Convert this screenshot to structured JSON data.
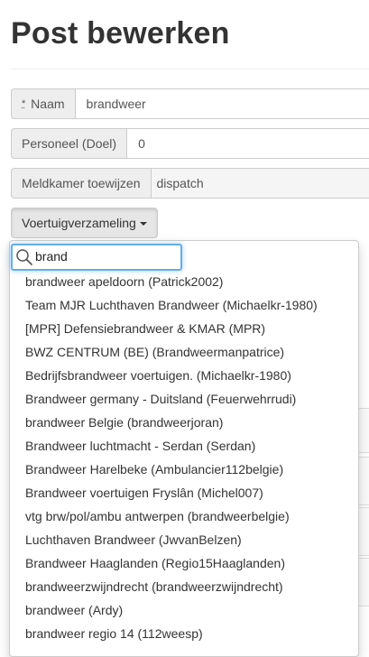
{
  "page": {
    "title": "Post bewerken"
  },
  "form": {
    "naam": {
      "required_mark": "*",
      "label": "Naam",
      "value": "brandweer"
    },
    "personeel": {
      "label": "Personeel (Doel)",
      "value": "0"
    },
    "meldkamer": {
      "label": "Meldkamer toewijzen",
      "value": "dispatch"
    }
  },
  "vehicle_collection": {
    "button_label": "Voertuigverzameling",
    "search": {
      "value": "brand",
      "placeholder": ""
    },
    "options": [
      "brandweer apeldoorn (Patrick2002)",
      "Team MJR Luchthaven Brandweer (Michaelkr-1980)",
      "[MPR] Defensiebrandweer & KMAR (MPR)",
      "BWZ CENTRUM (BE) (Brandweermanpatrice)",
      "Bedrijfsbrandweer voertuigen. (Michaelkr-1980)",
      "Brandweer germany - Duitsland (Feuerwehrrudi)",
      "brandweer Belgie (brandweerjoran)",
      "Brandweer luchtmacht - Serdan (Serdan)",
      "Brandweer Harelbeke (Ambulancier112belgie)",
      "Brandweer voertuigen Fryslân (Michel007)",
      "vtg brw/pol/ambu antwerpen (brandweerbelgie)",
      "Luchthaven Brandweer (JwvanBelzen)",
      "Brandweer Haaglanden (Regio15Haaglanden)",
      "brandweerzwijndrecht (brandweerzwijndrecht)",
      "brandweer (Ardy)",
      "brandweer regio 14 (112weesp)"
    ]
  },
  "colors": {
    "focus": "#66afe9",
    "success": "#5cb85c"
  },
  "icons": {
    "search": "search-icon",
    "caret": "caret-down-icon"
  }
}
